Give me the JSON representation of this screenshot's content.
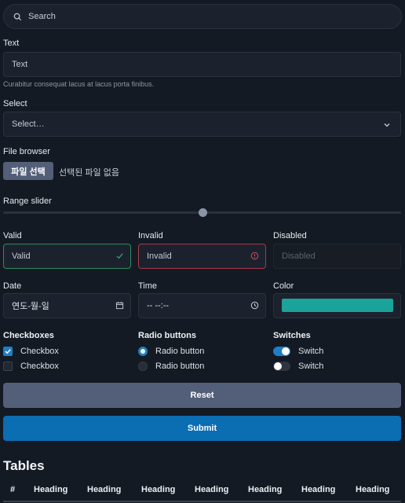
{
  "search": {
    "placeholder": "Search"
  },
  "text": {
    "label": "Text",
    "placeholder": "Text",
    "help": "Curabitur consequat lacus at lacus porta finibus."
  },
  "select": {
    "label": "Select",
    "value": "Select…"
  },
  "file": {
    "label": "File browser",
    "button": "파일 선택",
    "status": "선택된 파일 없음"
  },
  "range": {
    "label": "Range slider",
    "value": 0.5
  },
  "validation": {
    "valid": {
      "label": "Valid",
      "value": "Valid"
    },
    "invalid": {
      "label": "Invalid",
      "value": "Invalid"
    },
    "disabled": {
      "label": "Disabled",
      "value": "Disabled"
    }
  },
  "date": {
    "label": "Date",
    "value": "연도-월-일"
  },
  "time": {
    "label": "Time",
    "value": "-- --:--"
  },
  "color": {
    "label": "Color",
    "value": "#1aa39a"
  },
  "checkboxes": {
    "title": "Checkboxes",
    "items": [
      {
        "label": "Checkbox",
        "checked": true
      },
      {
        "label": "Checkbox",
        "checked": false
      }
    ]
  },
  "radios": {
    "title": "Radio buttons",
    "items": [
      {
        "label": "Radio button",
        "checked": true
      },
      {
        "label": "Radio button",
        "checked": false
      }
    ]
  },
  "switches": {
    "title": "Switches",
    "items": [
      {
        "label": "Switch",
        "on": true
      },
      {
        "label": "Switch",
        "on": false
      }
    ]
  },
  "buttons": {
    "reset": "Reset",
    "submit": "Submit"
  },
  "tables": {
    "title": "Tables",
    "headers": [
      "#",
      "Heading",
      "Heading",
      "Heading",
      "Heading",
      "Heading",
      "Heading",
      "Heading"
    ]
  }
}
